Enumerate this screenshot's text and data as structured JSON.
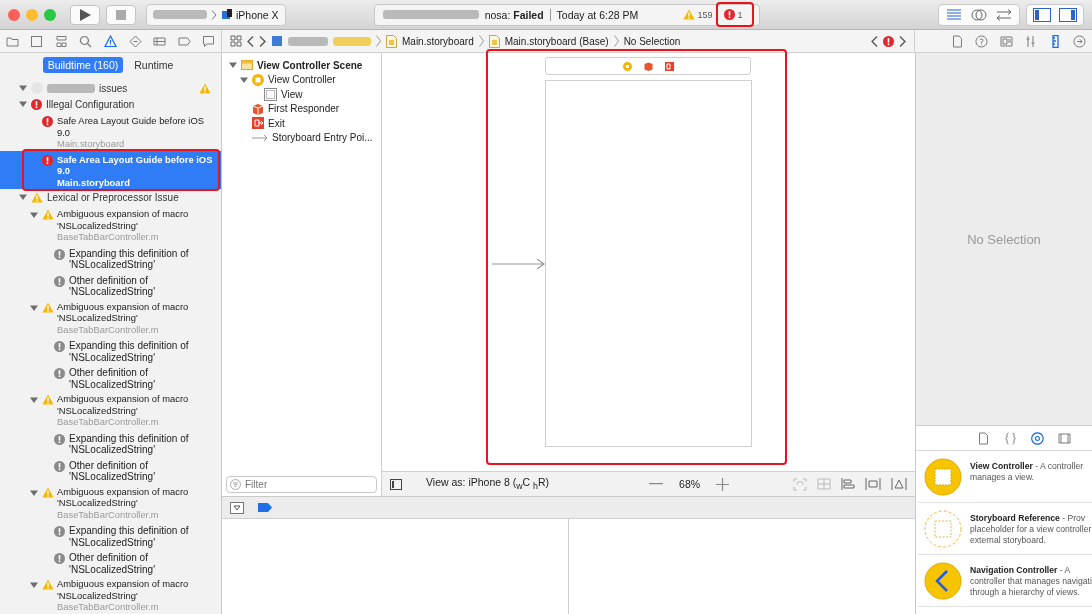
{
  "toolbar": {
    "device": "iPhone X",
    "status": "nosa: **Failed**",
    "time": "Today at 6:28 PM",
    "warning_count": "159",
    "error_count": "1"
  },
  "nav_icons": [
    {
      "kind": "folder",
      "selected": false
    },
    {
      "kind": "source",
      "selected": false
    },
    {
      "kind": "symbol",
      "selected": false
    },
    {
      "kind": "search",
      "selected": false
    },
    {
      "kind": "issue",
      "selected": true
    },
    {
      "kind": "test",
      "selected": false
    },
    {
      "kind": "debug",
      "selected": false
    },
    {
      "kind": "breakpoint",
      "selected": false
    },
    {
      "kind": "report",
      "selected": false
    }
  ],
  "breadcrumbs": [
    {
      "label": "Main.storyboard",
      "kind": "file"
    },
    {
      "label": "Main.storyboard (Base)",
      "kind": "file"
    },
    {
      "label": "No Selection",
      "kind": "plain"
    }
  ],
  "inspector_icons": [
    {
      "kind": "file",
      "selected": false
    },
    {
      "kind": "help",
      "selected": false
    },
    {
      "kind": "identity",
      "selected": false
    },
    {
      "kind": "attributes",
      "selected": false
    },
    {
      "kind": "size",
      "selected": true
    },
    {
      "kind": "connections",
      "selected": false
    }
  ],
  "navigator": {
    "tabs": [
      {
        "label": "Buildtime (160)",
        "selected": true
      },
      {
        "label": "Runtime",
        "selected": false
      }
    ],
    "project": {
      "label": "issues",
      "expanded": true,
      "kind": "warning"
    },
    "groups": [
      {
        "title": "Illegal Configuration",
        "kind": "error",
        "expanded": true,
        "issues": [
          {
            "title": "Safe Area Layout Guide before iOS 9.0",
            "file": "Main.storyboard",
            "kind": "error",
            "selected": false
          },
          {
            "title": "Safe Area Layout Guide before iOS 9.0",
            "file": "Main.storyboard",
            "kind": "error",
            "selected": true
          }
        ]
      },
      {
        "title": "Lexical or Preprocessor Issue",
        "kind": "warning",
        "expanded": true,
        "issues": [
          {
            "title": "Ambiguous expansion of macro 'NSLocalizedString'",
            "file": "BaseTabBarController.m",
            "kind": "warning",
            "selected": false,
            "expanded": true,
            "notes": [
              {
                "text": "Expanding this definition of 'NSLocalizedString'",
                "kind": "note"
              },
              {
                "text": "Other definition of 'NSLocalizedString'",
                "kind": "note"
              }
            ]
          },
          {
            "title": "Ambiguous expansion of macro 'NSLocalizedString'",
            "file": "BaseTabBarController.m",
            "kind": "warning",
            "selected": false,
            "expanded": true,
            "notes": [
              {
                "text": "Expanding this definition of 'NSLocalizedString'",
                "kind": "note"
              },
              {
                "text": "Other definition of 'NSLocalizedString'",
                "kind": "note"
              }
            ]
          },
          {
            "title": "Ambiguous expansion of macro 'NSLocalizedString'",
            "file": "BaseTabBarController.m",
            "kind": "warning",
            "selected": false,
            "expanded": true,
            "notes": [
              {
                "text": "Expanding this definition of 'NSLocalizedString'",
                "kind": "note"
              },
              {
                "text": "Other definition of 'NSLocalizedString'",
                "kind": "note"
              }
            ]
          },
          {
            "title": "Ambiguous expansion of macro 'NSLocalizedString'",
            "file": "BaseTabBarController.m",
            "kind": "warning",
            "selected": false,
            "expanded": true,
            "notes": [
              {
                "text": "Expanding this definition of 'NSLocalizedString'",
                "kind": "note"
              },
              {
                "text": "Other definition of 'NSLocalizedString'",
                "kind": "note"
              }
            ]
          },
          {
            "title": "Ambiguous expansion of macro 'NSLocalizedString'",
            "file": "BaseTabBarController.m",
            "kind": "warning",
            "selected": false,
            "expanded": true
          }
        ]
      }
    ]
  },
  "outline": {
    "tree": [
      {
        "label": "View Controller Scene",
        "kind": "scene",
        "expanded": true,
        "children": [
          {
            "label": "View Controller",
            "kind": "controller",
            "expanded": true,
            "children": [
              {
                "label": "View",
                "kind": "view"
              }
            ]
          },
          {
            "label": "First Responder",
            "kind": "responder"
          },
          {
            "label": "Exit",
            "kind": "exit"
          },
          {
            "label": "Storyboard Entry Poi...",
            "kind": "entry"
          }
        ]
      }
    ],
    "filter": {
      "placeholder": "Filter"
    }
  },
  "canvas": {
    "view_as": "View as: iPhone 8 ($_{w}$C $_{h}$R)",
    "zoom": "68%"
  },
  "inspector": {
    "empty_message": "No Selection"
  },
  "library": {
    "tabs": [
      {
        "kind": "file",
        "selected": false
      },
      {
        "kind": "code",
        "selected": false
      },
      {
        "kind": "object",
        "selected": true
      },
      {
        "kind": "media",
        "selected": false
      }
    ],
    "items": [
      {
        "kind": "controller",
        "lines": [
          "**View Controller** - A controller",
          "manages a view."
        ]
      },
      {
        "kind": "reference",
        "lines": [
          "**Storyboard Reference** - Prov",
          "placeholder for a view controller",
          "external storyboard."
        ]
      },
      {
        "kind": "navigation",
        "lines": [
          "**Navigation Controller** - A",
          "controller that manages navigati",
          "through a hierarchy of views."
        ]
      }
    ]
  }
}
